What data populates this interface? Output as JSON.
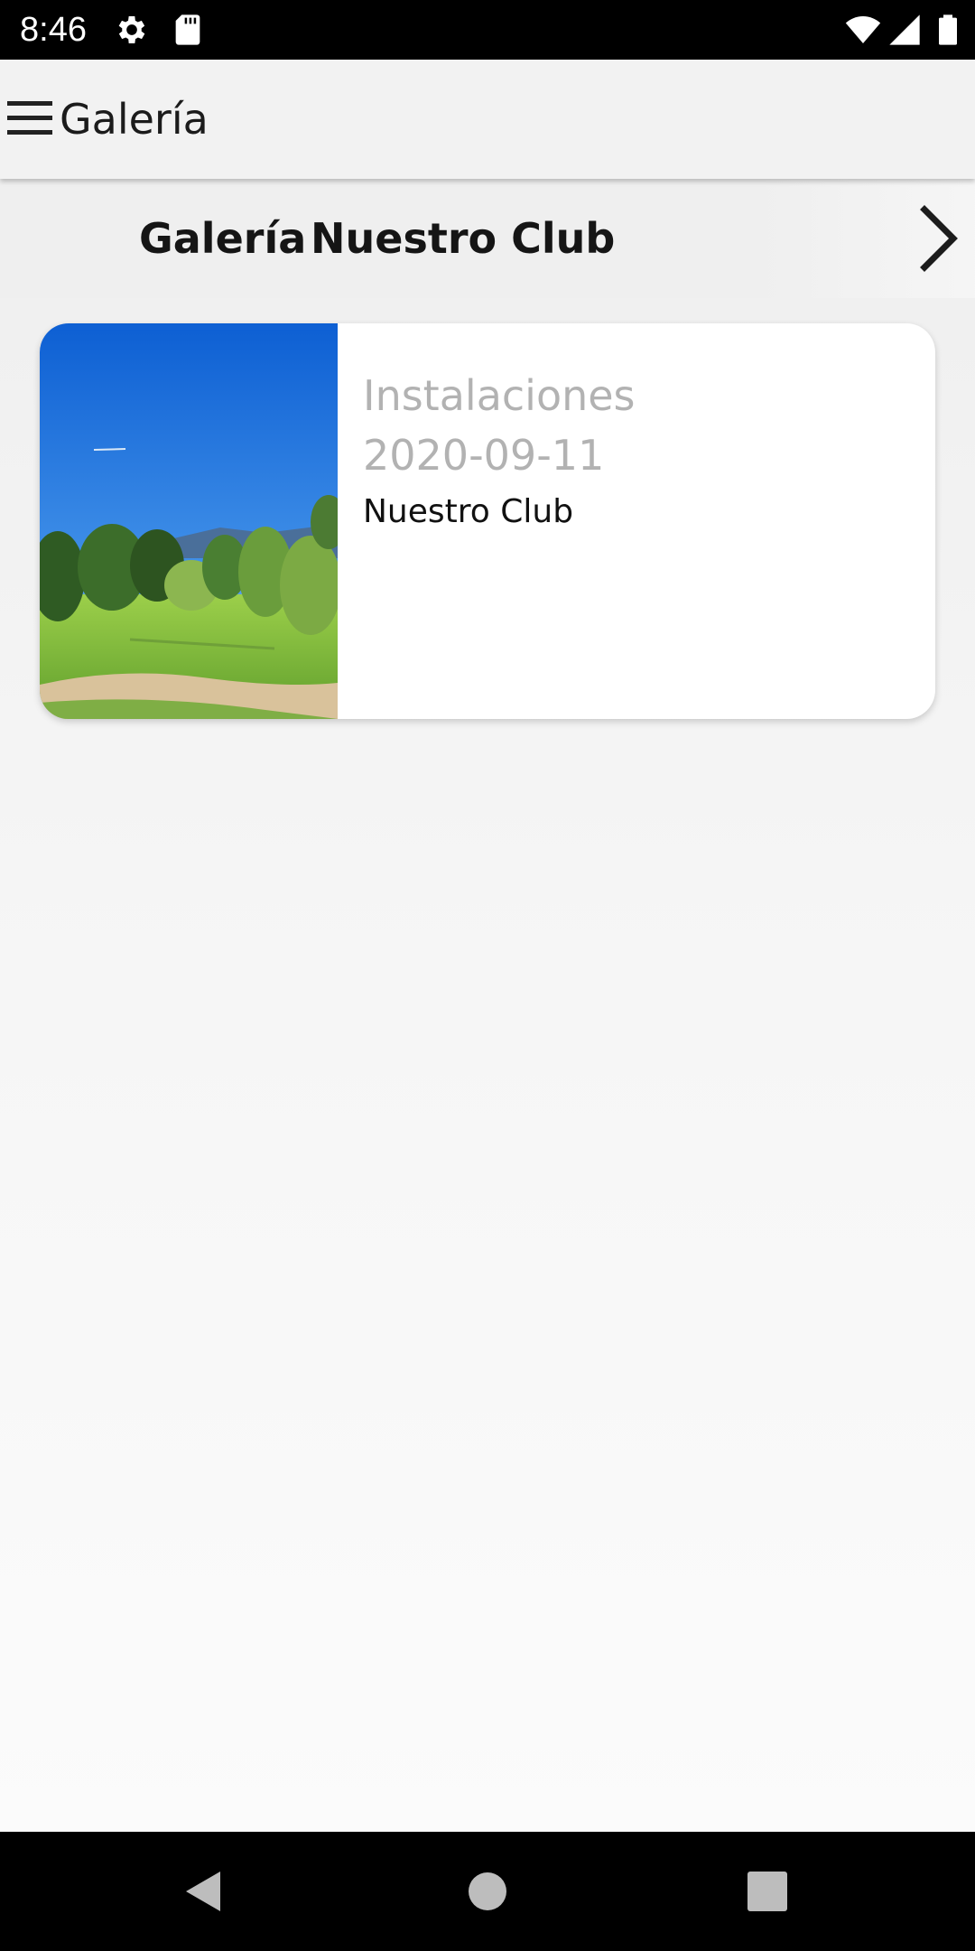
{
  "status_bar": {
    "time": "8:46",
    "icons": [
      "settings-icon",
      "sd-card-icon",
      "wifi-icon",
      "signal-icon",
      "battery-icon"
    ]
  },
  "app_bar": {
    "menu_icon": "hamburger-menu-icon",
    "title": "Galería"
  },
  "category_strip": {
    "items": [
      {
        "label": "Galería",
        "selected": false
      },
      {
        "label": "Nuestro Club",
        "selected": true
      }
    ],
    "next_icon": "chevron-right-icon"
  },
  "gallery": {
    "cards": [
      {
        "title": "Instalaciones",
        "date": "2020-09-11",
        "category": "Nuestro Club",
        "image": "golf-course-photo"
      }
    ]
  },
  "nav_bar": {
    "icons": [
      "back-icon",
      "home-icon",
      "recents-icon"
    ]
  },
  "colors": {
    "background": "#f4f4f4",
    "card_background": "#ffffff",
    "muted_text": "#b2b2b2",
    "primary_text": "#151515",
    "system_bars": "#000000"
  }
}
